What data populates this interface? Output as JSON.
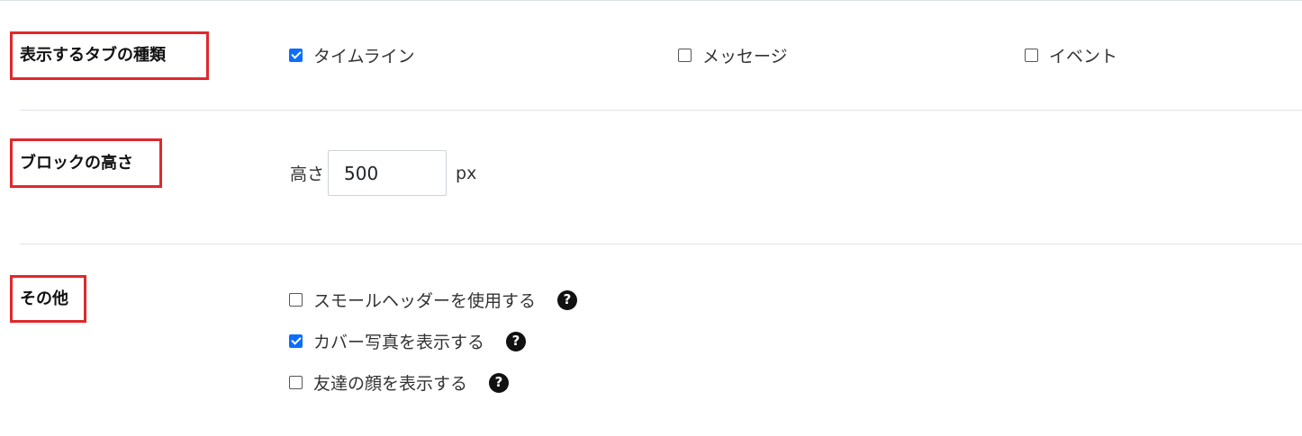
{
  "sections": {
    "tabs": {
      "label": "表示するタブの種類",
      "options": [
        {
          "label": "タイムライン",
          "checked": true
        },
        {
          "label": "メッセージ",
          "checked": false
        },
        {
          "label": "イベント",
          "checked": false
        }
      ]
    },
    "height": {
      "label": "ブロックの高さ",
      "prefix": "高さ",
      "value": "500",
      "unit": "px"
    },
    "other": {
      "label": "その他",
      "options": [
        {
          "label": "スモールヘッダーを使用する",
          "checked": false,
          "help": "?"
        },
        {
          "label": "カバー写真を表示する",
          "checked": true,
          "help": "?"
        },
        {
          "label": "友達の顔を表示する",
          "checked": false,
          "help": "?"
        }
      ]
    }
  },
  "colors": {
    "highlight_border": "#e0282b",
    "checkbox_checked": "#0d6efd",
    "divider": "#dee2e6"
  }
}
